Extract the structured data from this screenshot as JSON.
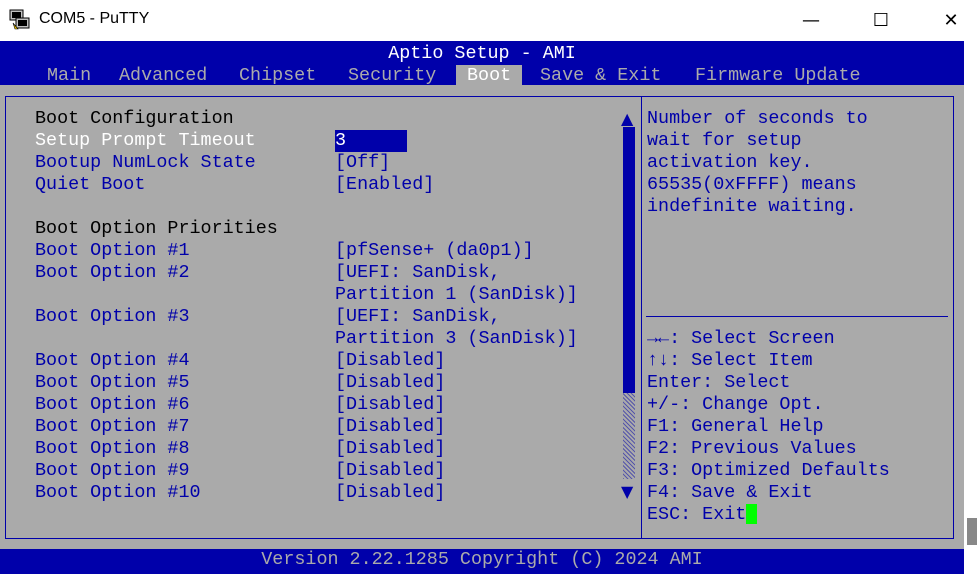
{
  "window": {
    "title": "COM5 - PuTTY",
    "minimize": "—",
    "maximize": "☐",
    "close": "✕"
  },
  "header": {
    "title": "Aptio Setup - AMI",
    "tabs": [
      {
        "label": "Main"
      },
      {
        "label": "Advanced"
      },
      {
        "label": "Chipset"
      },
      {
        "label": "Security"
      },
      {
        "label": "Boot"
      },
      {
        "label": "Save & Exit"
      },
      {
        "label": "Firmware Update"
      }
    ]
  },
  "boot": {
    "section1": "Boot Configuration",
    "setup_prompt_timeout": {
      "label": "Setup Prompt Timeout",
      "value": "3"
    },
    "numlock": {
      "label": "Bootup NumLock State",
      "value": "[Off]"
    },
    "quiet_boot": {
      "label": "Quiet Boot",
      "value": "[Enabled]"
    },
    "section2": "Boot Option Priorities",
    "options": [
      {
        "label": "Boot Option #1",
        "value": "[pfSense+ (da0p1)]",
        "value2": ""
      },
      {
        "label": "Boot Option #2",
        "value": "[UEFI: SanDisk,",
        "value2": "Partition 1 (SanDisk)]"
      },
      {
        "label": "Boot Option #3",
        "value": "[UEFI: SanDisk,",
        "value2": "Partition 3 (SanDisk)]"
      },
      {
        "label": "Boot Option #4",
        "value": "[Disabled]",
        "value2": ""
      },
      {
        "label": "Boot Option #5",
        "value": "[Disabled]",
        "value2": ""
      },
      {
        "label": "Boot Option #6",
        "value": "[Disabled]",
        "value2": ""
      },
      {
        "label": "Boot Option #7",
        "value": "[Disabled]",
        "value2": ""
      },
      {
        "label": "Boot Option #8",
        "value": "[Disabled]",
        "value2": ""
      },
      {
        "label": "Boot Option #9",
        "value": "[Disabled]",
        "value2": ""
      },
      {
        "label": "Boot Option #10",
        "value": "[Disabled]",
        "value2": ""
      }
    ]
  },
  "help": {
    "lines": [
      "Number of seconds to",
      "wait for setup",
      "activation key.",
      "65535(0xFFFF) means",
      "indefinite waiting."
    ]
  },
  "keys": [
    "→←: Select Screen",
    "↑↓: Select Item",
    "Enter: Select",
    "+/-: Change Opt.",
    "F1: General Help",
    "F2: Previous Values",
    "F3: Optimized Defaults",
    "F4: Save & Exit",
    "ESC: Exit"
  ],
  "scroll": {
    "up": "▲",
    "down": "▼"
  },
  "footer": {
    "version": "Version 2.22.1285 Copyright (C) 2024 AMI"
  }
}
